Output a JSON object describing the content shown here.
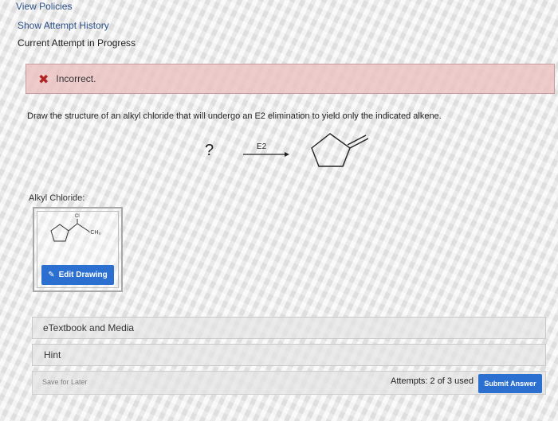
{
  "nav": {
    "view_policies": "View Policies",
    "show_attempt_history": "Show Attempt History",
    "current_attempt": "Current Attempt in Progress"
  },
  "feedback": {
    "status": "Incorrect.",
    "icon": "x-icon",
    "color": "#b02323"
  },
  "question": {
    "text": "Draw the structure of an alkyl chloride that will undergo an E2 elimination to yield only the indicated alkene.",
    "unknown_symbol": "?",
    "arrow_label": "E2"
  },
  "answer": {
    "label": "Alkyl Chloride:",
    "atom_cl": "Cl",
    "group_ch3": "-CH₃",
    "edit_button": "Edit Drawing"
  },
  "resources": {
    "etextbook": "eTextbook and Media",
    "hint": "Hint"
  },
  "footer": {
    "save_later": "Save for Later",
    "attempts": "Attempts: 2 of 3 used",
    "submit": "Submit Answer"
  },
  "colors": {
    "accent": "#2b6fd1",
    "error_bg": "#ebc3c3"
  }
}
